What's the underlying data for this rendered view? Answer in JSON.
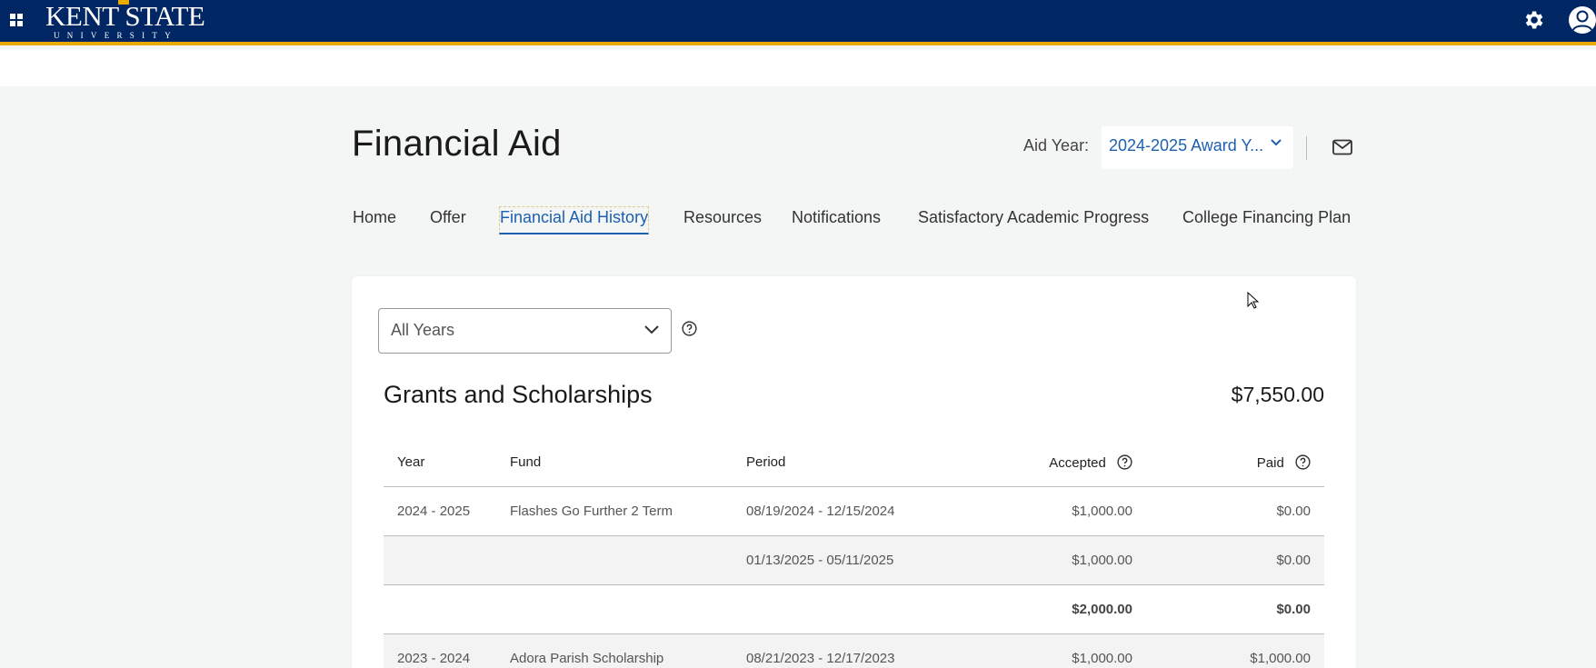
{
  "header": {
    "logo_main": "KENT STATE",
    "logo_sub": "UNIVERSITY",
    "brand_color": "#002664",
    "accent_color": "#eaab00",
    "icons": [
      "apps-grid-icon",
      "gear-icon",
      "user-avatar-icon"
    ]
  },
  "page": {
    "title": "Financial Aid",
    "aid_year_label": "Aid Year:",
    "aid_year_value": "2024-2025 Award Y...",
    "link_color": "#1d5fb0"
  },
  "tabs": [
    {
      "label": "Home",
      "active": false
    },
    {
      "label": "Offer",
      "active": false
    },
    {
      "label": "Financial Aid History",
      "active": true
    },
    {
      "label": "Resources",
      "active": false
    },
    {
      "label": "Notifications",
      "active": false
    },
    {
      "label": "Satisfactory Academic Progress",
      "active": false
    },
    {
      "label": "College Financing Plan",
      "active": false
    }
  ],
  "filter": {
    "selected": "All Years"
  },
  "grants": {
    "title": "Grants and Scholarships",
    "total": "$7,550.00",
    "columns": {
      "year": "Year",
      "fund": "Fund",
      "period": "Period",
      "accepted": "Accepted",
      "paid": "Paid"
    },
    "rows": [
      {
        "year": "2024 - 2025",
        "fund": "Flashes Go Further 2 Term",
        "period": "08/19/2024 - 12/15/2024",
        "accepted": "$1,000.00",
        "paid": "$0.00"
      },
      {
        "year": "",
        "fund": "",
        "period": "01/13/2025 - 05/11/2025",
        "accepted": "$1,000.00",
        "paid": "$0.00"
      },
      {
        "year": "",
        "fund": "",
        "period": "",
        "accepted": "$2,000.00",
        "paid": "$0.00"
      },
      {
        "year": "2023 - 2024",
        "fund": "Adora Parish Scholarship",
        "period": "08/21/2023 - 12/17/2023",
        "accepted": "$1,000.00",
        "paid": "$1,000.00"
      }
    ]
  }
}
